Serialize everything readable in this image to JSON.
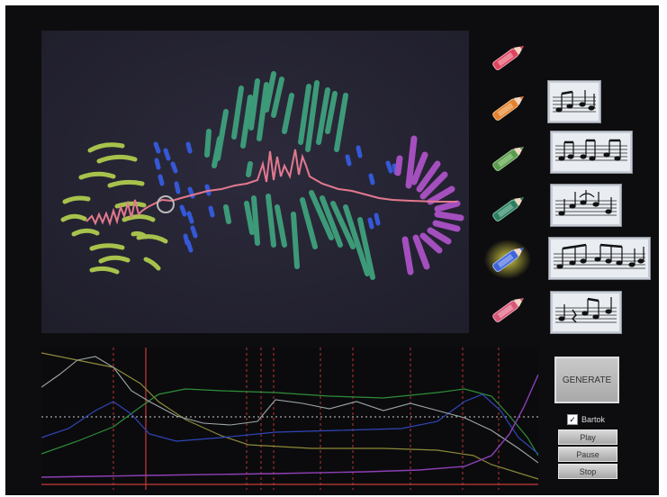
{
  "colors": {
    "accent_red": "#e0435d",
    "accent_orange": "#e2812f",
    "accent_green": "#5a9a4e",
    "accent_teal": "#2f7d60",
    "accent_blue": "#3c63d8",
    "accent_pink": "#d65776",
    "highlight_glow": "#e8e04a"
  },
  "crayons": [
    {
      "name": "red-crayon",
      "color": "#e0435d",
      "selected": false
    },
    {
      "name": "orange-crayon",
      "color": "#e2812f",
      "selected": false
    },
    {
      "name": "olive-green-crayon",
      "color": "#5a9a4e",
      "selected": false
    },
    {
      "name": "teal-crayon",
      "color": "#2f7d60",
      "selected": false
    },
    {
      "name": "blue-crayon",
      "color": "#3c63d8",
      "selected": true
    },
    {
      "name": "pink-crayon",
      "color": "#d65776",
      "selected": false
    }
  ],
  "controls": {
    "generate_label": "GENERATE",
    "bartok_label": "Bartok",
    "bartok_checked": true,
    "play_label": "Play",
    "pause_label": "Pause",
    "stop_label": "Stop"
  }
}
